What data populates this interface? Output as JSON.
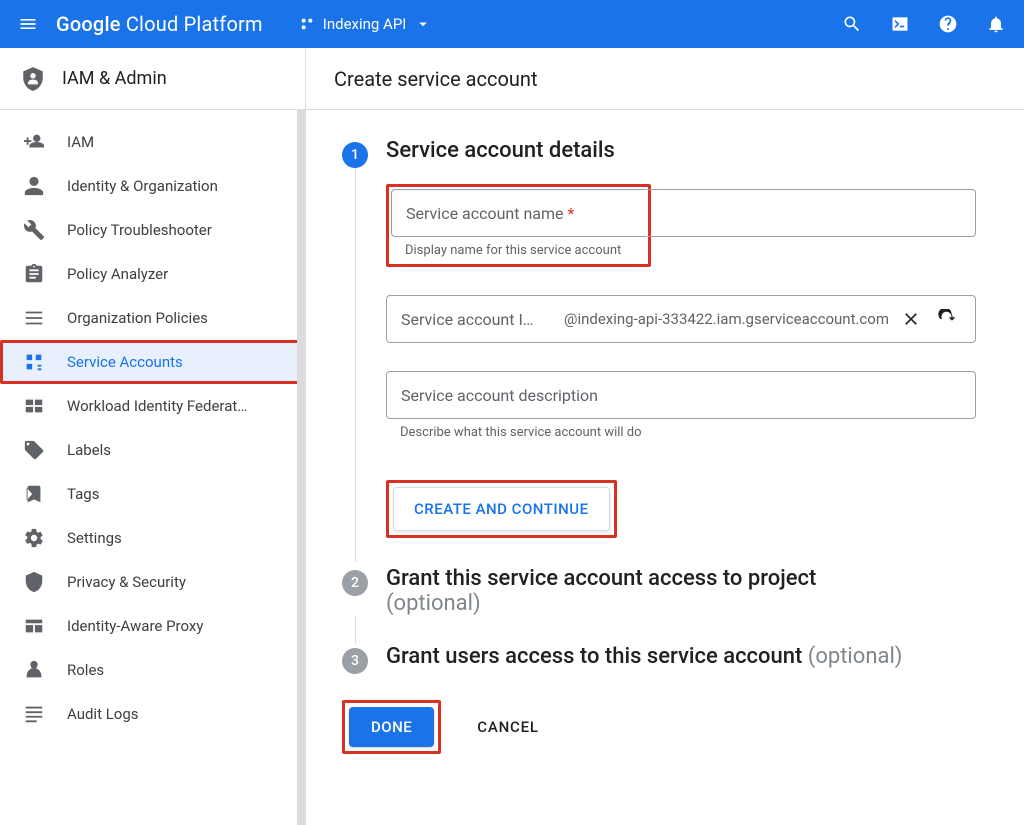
{
  "appbar": {
    "brand_prefix": "Google",
    "brand_rest": " Cloud Platform",
    "project_name": "Indexing API"
  },
  "sidebar": {
    "section_title": "IAM & Admin",
    "items": [
      {
        "label": "IAM",
        "active": false
      },
      {
        "label": "Identity & Organization",
        "active": false
      },
      {
        "label": "Policy Troubleshooter",
        "active": false
      },
      {
        "label": "Policy Analyzer",
        "active": false
      },
      {
        "label": "Organization Policies",
        "active": false
      },
      {
        "label": "Service Accounts",
        "active": true
      },
      {
        "label": "Workload Identity Federat…",
        "active": false
      },
      {
        "label": "Labels",
        "active": false
      },
      {
        "label": "Tags",
        "active": false
      },
      {
        "label": "Settings",
        "active": false
      },
      {
        "label": "Privacy & Security",
        "active": false
      },
      {
        "label": "Identity-Aware Proxy",
        "active": false
      },
      {
        "label": "Roles",
        "active": false
      },
      {
        "label": "Audit Logs",
        "active": false
      }
    ]
  },
  "main": {
    "page_title": "Create service account",
    "step1_title": "Service account details",
    "name_label": "Service account name",
    "name_helper": "Display name for this service account",
    "id_label": "Service account I…",
    "id_suffix": "@indexing-api-333422.iam.gserviceaccount.com",
    "desc_label": "Service account description",
    "desc_helper": "Describe what this service account will do",
    "create_btn": "CREATE AND CONTINUE",
    "step2_title": "Grant this service account access to project",
    "step3_title": "Grant users access to this service account",
    "optional": "(optional)",
    "done_btn": "DONE",
    "cancel_btn": "CANCEL"
  }
}
